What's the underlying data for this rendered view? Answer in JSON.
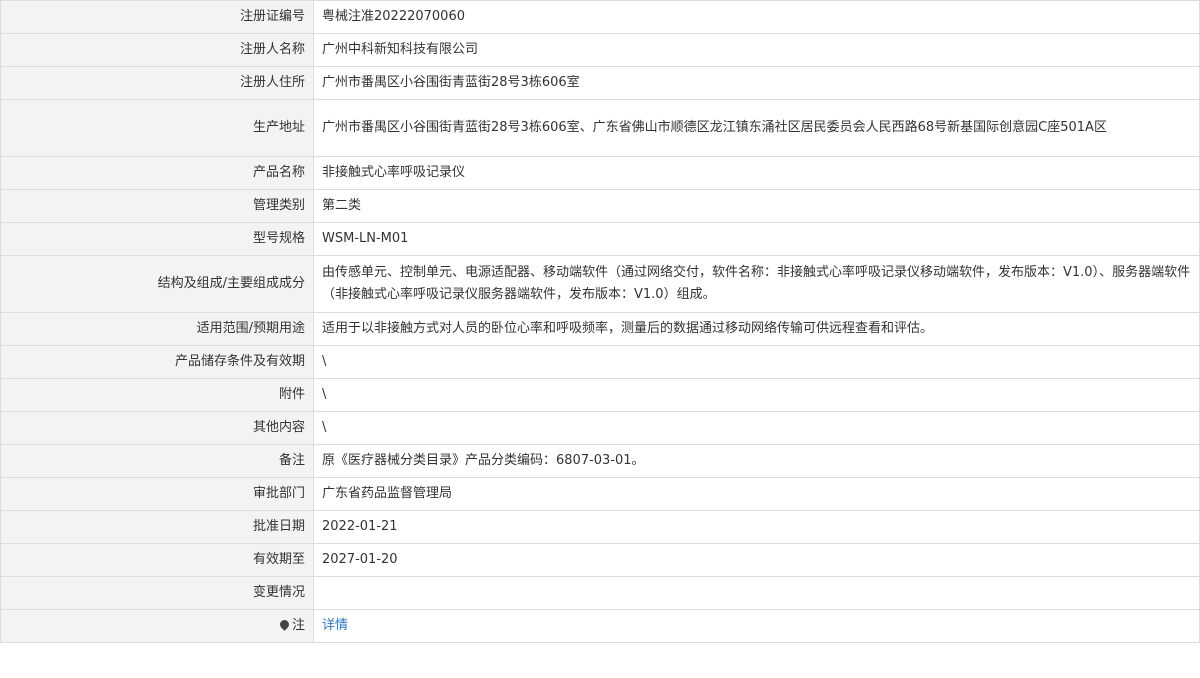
{
  "rows": [
    {
      "label": "注册证编号",
      "value": "粤械注准20222070060"
    },
    {
      "label": "注册人名称",
      "value": "广州中科新知科技有限公司"
    },
    {
      "label": "注册人住所",
      "value": "广州市番禺区小谷围街青蓝街28号3栋606室"
    },
    {
      "label": "生产地址",
      "value": "广州市番禺区小谷围街青蓝街28号3栋606室、广东省佛山市顺德区龙江镇东涌社区居民委员会人民西路68号新基国际创意园C座501A区"
    },
    {
      "label": "产品名称",
      "value": "非接触式心率呼吸记录仪"
    },
    {
      "label": "管理类别",
      "value": "第二类"
    },
    {
      "label": "型号规格",
      "value": "WSM-LN-M01"
    },
    {
      "label": "结构及组成/主要组成成分",
      "value": "由传感单元、控制单元、电源适配器、移动端软件（通过网络交付，软件名称：非接触式心率呼吸记录仪移动端软件，发布版本：V1.0）、服务器端软件（非接触式心率呼吸记录仪服务器端软件，发布版本：V1.0）组成。"
    },
    {
      "label": "适用范围/预期用途",
      "value": "适用于以非接触方式对人员的卧位心率和呼吸频率，测量后的数据通过移动网络传输可供远程查看和评估。"
    },
    {
      "label": "产品储存条件及有效期",
      "value": "\\"
    },
    {
      "label": "附件",
      "value": "\\"
    },
    {
      "label": "其他内容",
      "value": "\\"
    },
    {
      "label": "备注",
      "value": "原《医疗器械分类目录》产品分类编码：6807-03-01。"
    },
    {
      "label": "审批部门",
      "value": "广东省药品监督管理局"
    },
    {
      "label": "批准日期",
      "value": "2022-01-21"
    },
    {
      "label": "有效期至",
      "value": "2027-01-20"
    },
    {
      "label": "变更情况",
      "value": ""
    },
    {
      "label": "注",
      "value": "详情"
    }
  ],
  "icons": {
    "note_pin": "map-pin-icon"
  }
}
